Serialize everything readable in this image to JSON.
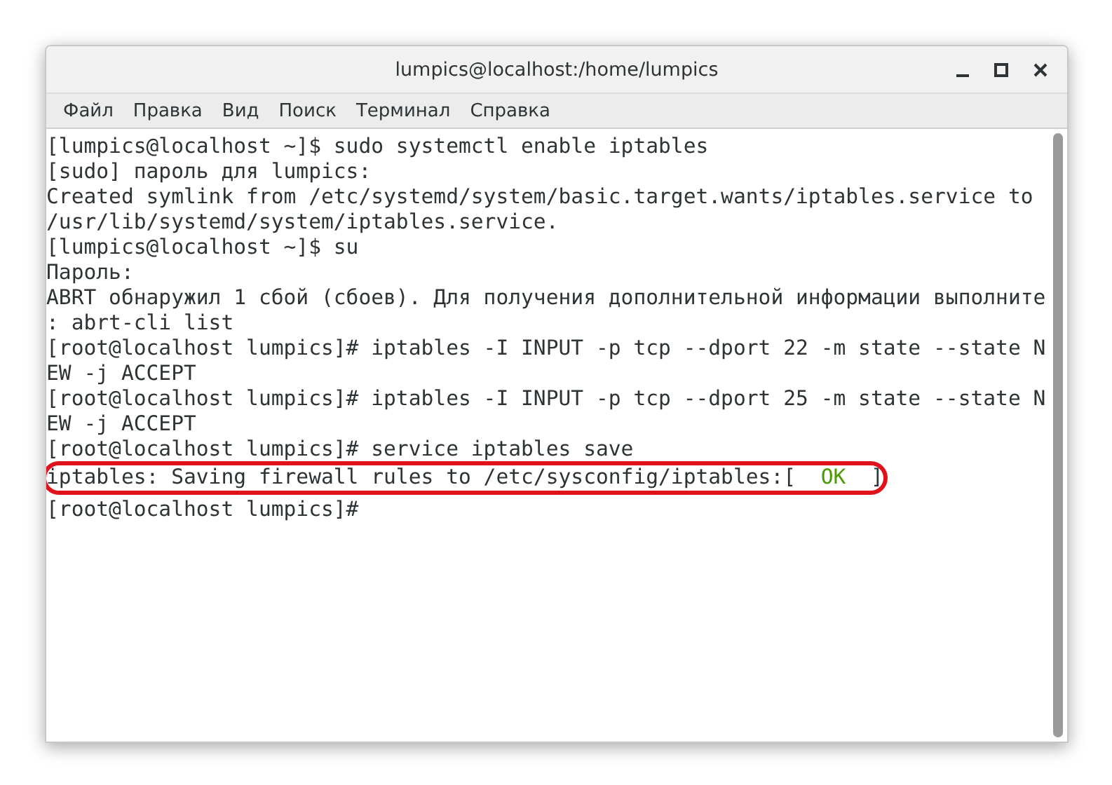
{
  "window": {
    "title": "lumpics@localhost:/home/lumpics"
  },
  "menu": [
    "Файл",
    "Правка",
    "Вид",
    "Поиск",
    "Терминал",
    "Справка"
  ],
  "terminal": {
    "lines": [
      {
        "highlighted": false,
        "segments": [
          {
            "kind": "normal",
            "text": "[lumpics@localhost ~]$ sudo systemctl enable iptables"
          }
        ]
      },
      {
        "highlighted": false,
        "segments": [
          {
            "kind": "normal",
            "text": "[sudo] пароль для lumpics:"
          }
        ]
      },
      {
        "highlighted": false,
        "segments": [
          {
            "kind": "normal",
            "text": "Created symlink from /etc/systemd/system/basic.target.wants/iptables.service to"
          }
        ]
      },
      {
        "highlighted": false,
        "segments": [
          {
            "kind": "normal",
            "text": "/usr/lib/systemd/system/iptables.service."
          }
        ]
      },
      {
        "highlighted": false,
        "segments": [
          {
            "kind": "normal",
            "text": "[lumpics@localhost ~]$ su"
          }
        ]
      },
      {
        "highlighted": false,
        "segments": [
          {
            "kind": "normal",
            "text": "Пароль:"
          }
        ]
      },
      {
        "highlighted": false,
        "segments": [
          {
            "kind": "normal",
            "text": "ABRT обнаружил 1 сбой (сбоев). Для получения дополнительной информации выполните"
          }
        ]
      },
      {
        "highlighted": false,
        "segments": [
          {
            "kind": "normal",
            "text": ": abrt-cli list"
          }
        ]
      },
      {
        "highlighted": false,
        "segments": [
          {
            "kind": "normal",
            "text": "[root@localhost lumpics]# iptables -I INPUT -p tcp --dport 22 -m state --state N"
          }
        ]
      },
      {
        "highlighted": false,
        "segments": [
          {
            "kind": "normal",
            "text": "EW -j ACCEPT"
          }
        ]
      },
      {
        "highlighted": false,
        "segments": [
          {
            "kind": "normal",
            "text": "[root@localhost lumpics]# iptables -I INPUT -p tcp --dport 25 -m state --state N"
          }
        ]
      },
      {
        "highlighted": false,
        "segments": [
          {
            "kind": "normal",
            "text": "EW -j ACCEPT"
          }
        ]
      },
      {
        "highlighted": false,
        "segments": [
          {
            "kind": "normal",
            "text": "[root@localhost lumpics]# service iptables save"
          }
        ]
      },
      {
        "highlighted": true,
        "segments": [
          {
            "kind": "normal",
            "text": "iptables: Saving firewall rules to /etc/sysconfig/iptables:[  "
          },
          {
            "kind": "ok",
            "text": "OK"
          },
          {
            "kind": "normal",
            "text": "  ]"
          }
        ]
      },
      {
        "highlighted": false,
        "segments": [
          {
            "kind": "normal",
            "text": "[root@localhost lumpics]#"
          }
        ]
      }
    ]
  }
}
